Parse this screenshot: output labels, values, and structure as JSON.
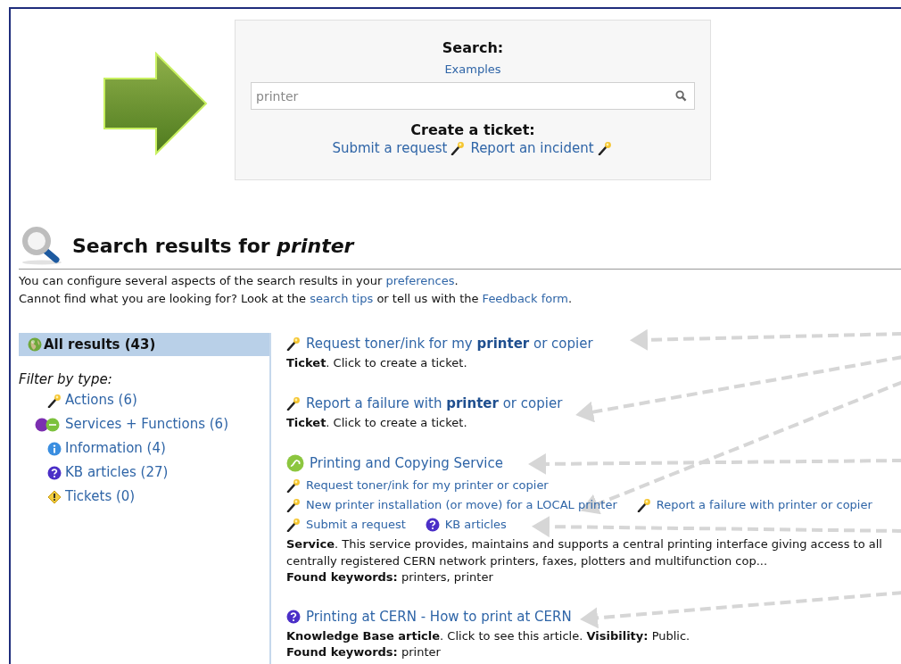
{
  "search_panel": {
    "title": "Search:",
    "examples_link": "Examples",
    "query": "printer",
    "create_title": "Create a ticket:",
    "ticket_links": [
      {
        "label": "Submit a request",
        "kind": "wand"
      },
      {
        "label": "Report an incident",
        "kind": "wand"
      }
    ]
  },
  "results_header": {
    "title": "Search results for *printer*"
  },
  "intro": [
    [
      {
        "kind": "text",
        "text": "You can configure several aspects of the search results in your "
      },
      {
        "kind": "link",
        "text": "preferences"
      },
      {
        "kind": "text",
        "text": "."
      }
    ],
    [
      {
        "kind": "text",
        "text": "Cannot find what you are looking for? Look at the "
      },
      {
        "kind": "link",
        "text": "search tips"
      },
      {
        "kind": "text",
        "text": " or tell us with the "
      },
      {
        "kind": "link",
        "text": "Feedback form"
      },
      {
        "kind": "text",
        "text": "."
      }
    ]
  ],
  "sidebar": {
    "all_results": {
      "label": "All results (43)",
      "kind": "globe",
      "selected": true
    },
    "filter_title": "Filter by type:",
    "filters": [
      {
        "label": "Actions (6)",
        "kind": "wand",
        "selected": false
      },
      {
        "label": "Services + Functions (6)",
        "kind": "fse",
        "selected": false
      },
      {
        "label": "Information (4)",
        "kind": "info",
        "selected": false
      },
      {
        "label": "KB articles (27)",
        "kind": "kb",
        "selected": false
      },
      {
        "label": "Tickets (0)",
        "kind": "warning",
        "selected": false
      }
    ]
  },
  "results": [
    {
      "kind": "wand",
      "title": "Request toner/ink for my **printer** or copier",
      "description": "**Ticket**. Click to create a ticket."
    },
    {
      "kind": "wand",
      "title": "Report a failure with **printer** or copier",
      "description": "**Ticket**. Click to create a ticket."
    },
    {
      "kind": "se",
      "title": "Printing and Copying Service",
      "links": [
        [
          {
            "kind": "wand",
            "label": "Request toner/ink for my printer or copier"
          }
        ],
        [
          {
            "kind": "wand",
            "label": "New printer installation (or move) for a LOCAL printer"
          },
          {
            "kind": "wand",
            "label": "Report a failure with printer or copier"
          }
        ],
        [
          {
            "kind": "wand",
            "label": "Submit a request"
          },
          {
            "kind": "kb",
            "label": "KB articles"
          }
        ]
      ],
      "description": "**Service**. This service provides, maintains and supports a central printing interface giving access to all\ncentrally registered CERN network printers, faxes, plotters and multifunction cop...",
      "keywords": "**Found keywords:** printers, printer"
    },
    {
      "kind": "kb",
      "title": "Printing at CERN - How to print at CERN",
      "description": "**Knowledge Base article**. Click to see this article. **Visibility:** Public.",
      "keywords": "**Found keywords:** printer"
    }
  ]
}
